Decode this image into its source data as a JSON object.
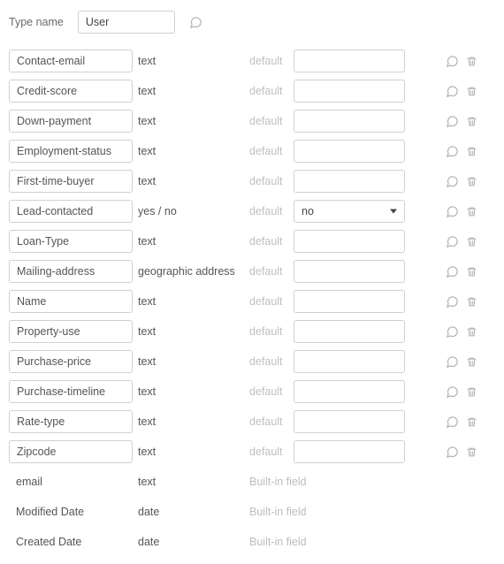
{
  "header": {
    "label": "Type name",
    "value": "User"
  },
  "default_label": "default",
  "builtin_label": "Built-in field",
  "fields": [
    {
      "name": "Contact-email",
      "type": "text",
      "kind": "text",
      "default": ""
    },
    {
      "name": "Credit-score",
      "type": "text",
      "kind": "text",
      "default": ""
    },
    {
      "name": "Down-payment",
      "type": "text",
      "kind": "text",
      "default": ""
    },
    {
      "name": "Employment-status",
      "type": "text",
      "kind": "text",
      "default": ""
    },
    {
      "name": "First-time-buyer",
      "type": "text",
      "kind": "text",
      "default": ""
    },
    {
      "name": "Lead-contacted",
      "type": "yes / no",
      "kind": "select",
      "default": "no"
    },
    {
      "name": "Loan-Type",
      "type": "text",
      "kind": "text",
      "default": ""
    },
    {
      "name": "Mailing-address",
      "type": "geographic address",
      "kind": "text",
      "default": ""
    },
    {
      "name": "Name",
      "type": "text",
      "kind": "text",
      "default": ""
    },
    {
      "name": "Property-use",
      "type": "text",
      "kind": "text",
      "default": ""
    },
    {
      "name": "Purchase-price",
      "type": "text",
      "kind": "text",
      "default": ""
    },
    {
      "name": "Purchase-timeline",
      "type": "text",
      "kind": "text",
      "default": ""
    },
    {
      "name": "Rate-type",
      "type": "text",
      "kind": "text",
      "default": ""
    },
    {
      "name": "Zipcode",
      "type": "text",
      "kind": "text",
      "default": ""
    }
  ],
  "builtin_fields": [
    {
      "name": "email",
      "type": "text"
    },
    {
      "name": "Modified Date",
      "type": "date"
    },
    {
      "name": "Created Date",
      "type": "date"
    }
  ]
}
